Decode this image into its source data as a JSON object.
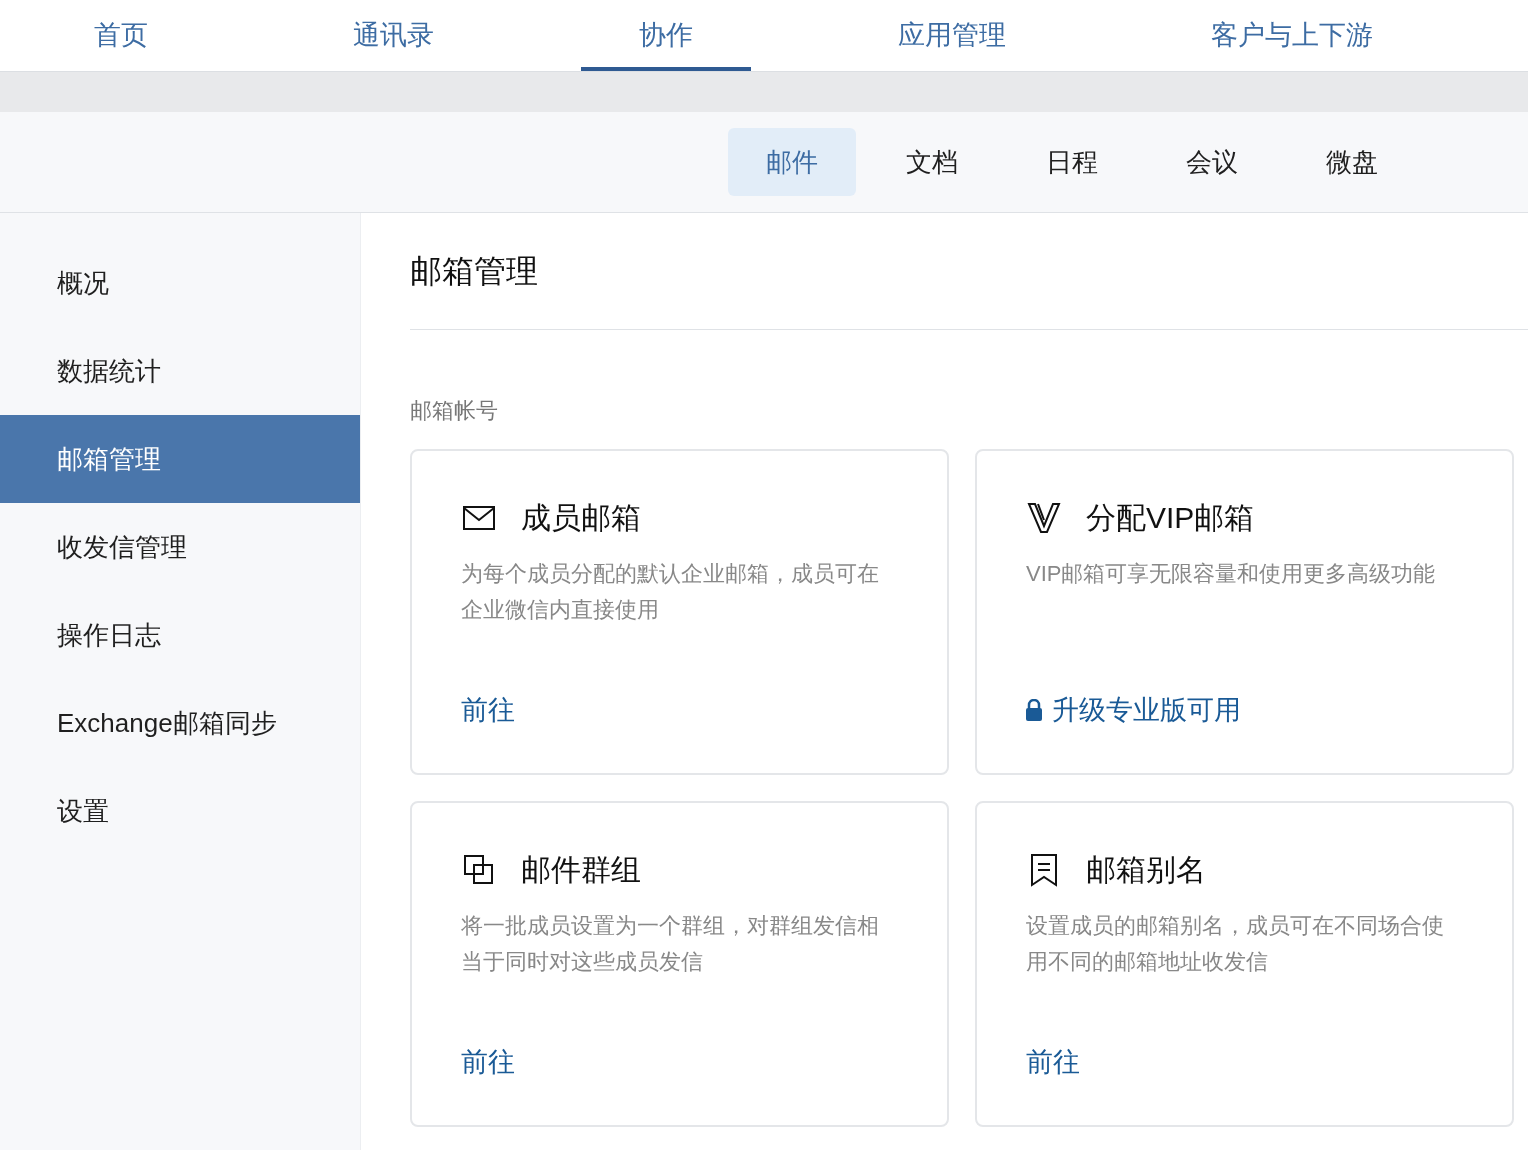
{
  "top_nav": [
    {
      "label": "首页",
      "selected": false
    },
    {
      "label": "通讯录",
      "selected": false
    },
    {
      "label": "协作",
      "selected": true
    },
    {
      "label": "应用管理",
      "selected": false
    },
    {
      "label": "客户与上下游",
      "selected": false
    }
  ],
  "sub_nav": [
    {
      "label": "邮件",
      "selected": true
    },
    {
      "label": "文档",
      "selected": false
    },
    {
      "label": "日程",
      "selected": false
    },
    {
      "label": "会议",
      "selected": false
    },
    {
      "label": "微盘",
      "selected": false
    }
  ],
  "sidebar": {
    "items": [
      {
        "label": "概况",
        "selected": false
      },
      {
        "label": "数据统计",
        "selected": false
      },
      {
        "label": "邮箱管理",
        "selected": true
      },
      {
        "label": "收发信管理",
        "selected": false
      },
      {
        "label": "操作日志",
        "selected": false
      },
      {
        "label": "Exchange邮箱同步",
        "selected": false
      },
      {
        "label": "设置",
        "selected": false
      }
    ]
  },
  "main": {
    "title": "邮箱管理",
    "section_label": "邮箱帐号",
    "cards": [
      {
        "kind": "envelope",
        "title": "成员邮箱",
        "description": "为每个成员分配的默认企业邮箱，成员可在企业微信内直接使用",
        "link": "前往",
        "locked": false
      },
      {
        "kind": "v",
        "title": "分配VIP邮箱",
        "description": "VIP邮箱可享无限容量和使用更多高级功能",
        "link": "升级专业版可用",
        "locked": true
      },
      {
        "kind": "squares",
        "title": "邮件群组",
        "description": "将一批成员设置为一个群组，对群组发信相当于同时对这些成员发信",
        "link": "前往",
        "locked": false
      },
      {
        "kind": "bookmark",
        "title": "邮箱别名",
        "description": "设置成员的邮箱别名，成员可在不同场合使用不同的邮箱地址收发信",
        "link": "前往",
        "locked": false
      }
    ]
  }
}
